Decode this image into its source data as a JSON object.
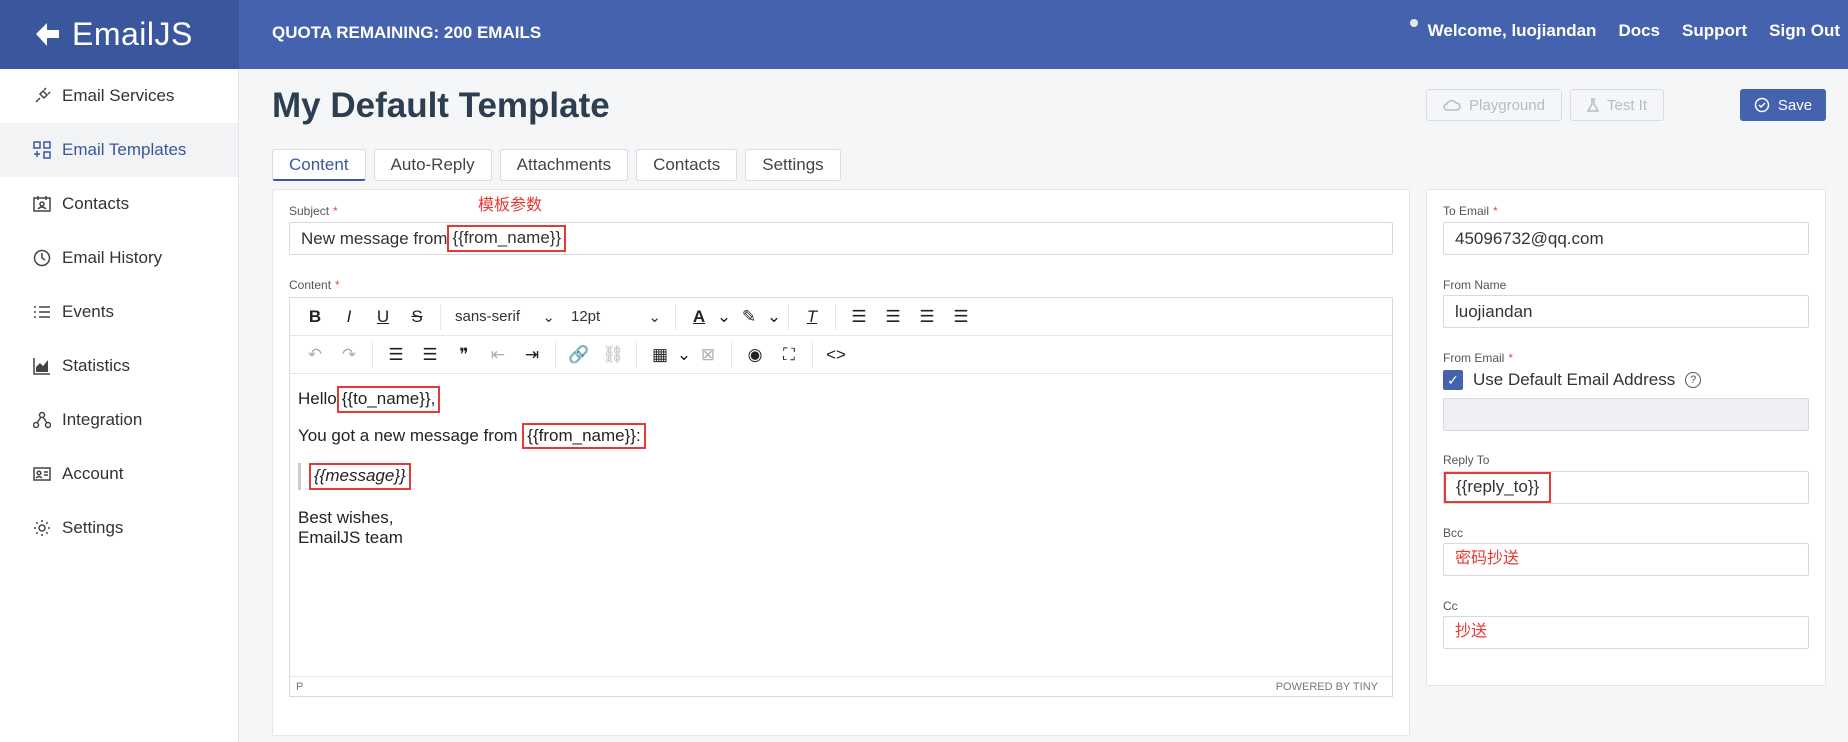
{
  "app": {
    "logo_text": "EmailJS",
    "quota": "QUOTA REMAINING: 200 EMAILS"
  },
  "topnav": {
    "welcome": "Welcome,",
    "username": "luojiandan",
    "docs": "Docs",
    "support": "Support",
    "signout": "Sign Out"
  },
  "sidebar": {
    "items": [
      {
        "label": "Email Services",
        "icon": "plug-icon"
      },
      {
        "label": "Email Templates",
        "icon": "templates-icon"
      },
      {
        "label": "Contacts",
        "icon": "contacts-icon"
      },
      {
        "label": "Email History",
        "icon": "history-icon"
      },
      {
        "label": "Events",
        "icon": "list-icon"
      },
      {
        "label": "Statistics",
        "icon": "chart-icon"
      },
      {
        "label": "Integration",
        "icon": "integration-icon"
      },
      {
        "label": "Account",
        "icon": "account-icon"
      },
      {
        "label": "Settings",
        "icon": "gear-icon"
      }
    ]
  },
  "page": {
    "title": "My Default Template"
  },
  "actions": {
    "playground": "Playground",
    "test": "Test It",
    "save": "Save"
  },
  "tabs": [
    "Content",
    "Auto-Reply",
    "Attachments",
    "Contacts",
    "Settings"
  ],
  "form": {
    "subject_label": "Subject",
    "subject_prefix": "New message from",
    "subject_var": "{{from_name}}",
    "annotation_template_params": "模板参数",
    "content_label": "Content"
  },
  "editor": {
    "font": "sans-serif",
    "size": "12pt",
    "line1_text": "Hello",
    "line1_var": "{{to_name}},",
    "line2_text": "You got a new message from",
    "line2_var": "{{from_name}}:",
    "quote_var": "{{message}}",
    "closing1": "Best wishes,",
    "closing2": "EmailJS team",
    "status_left": "P",
    "status_right": "POWERED BY TINY"
  },
  "right_panel": {
    "to_email_label": "To Email",
    "to_email": "45096732@qq.com",
    "from_name_label": "From Name",
    "from_name": "luojiandan",
    "from_email_label": "From Email",
    "use_default": "Use Default Email Address",
    "reply_to_label": "Reply To",
    "reply_to": "{{reply_to}}",
    "bcc_label": "Bcc",
    "bcc_note": "密码抄送",
    "cc_label": "Cc",
    "cc_note": "抄送"
  },
  "colors": {
    "brand": "#4462ad",
    "brand_dark": "#3a579e",
    "annotation": "#e53935"
  }
}
